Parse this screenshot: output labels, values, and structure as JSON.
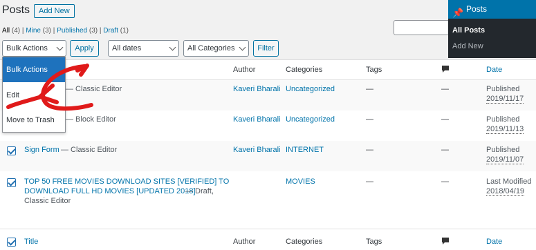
{
  "header": {
    "title": "Posts",
    "add_new": "Add New"
  },
  "filters": {
    "all": "All",
    "all_count": "(4)",
    "mine": "Mine",
    "mine_count": "(3)",
    "published": "Published",
    "published_count": "(3)",
    "draft": "Draft",
    "draft_count": "(1)",
    "sep": "|"
  },
  "toolbar": {
    "bulk_actions": "Bulk Actions",
    "apply": "Apply",
    "dates": "All dates",
    "categories": "All Categories",
    "filter": "Filter"
  },
  "bulk_menu": {
    "options": [
      "Bulk Actions",
      "Edit",
      "Move to Trash"
    ]
  },
  "table": {
    "columns": {
      "title": "Title",
      "author": "Author",
      "categories": "Categories",
      "tags": "Tags",
      "date": "Date"
    },
    "rows": [
      {
        "title": "",
        "suffix": "— Classic Editor",
        "author": "Kaveri Bharali",
        "category": "Uncategorized",
        "tags": "—",
        "comments": "—",
        "status": "Published",
        "date": "2019/11/17"
      },
      {
        "title": "",
        "suffix": "— Block Editor",
        "author": "Kaveri Bharali",
        "category": "Uncategorized",
        "tags": "—",
        "comments": "—",
        "status": "Published",
        "date": "2019/11/13"
      },
      {
        "title": "Sign Form",
        "suffix": "— Classic Editor",
        "author": "Kaveri Bharali",
        "category": "INTERNET",
        "tags": "—",
        "comments": "—",
        "status": "Published",
        "date": "2019/11/07"
      },
      {
        "title_line1": "TOP 50 FREE MOVIES DOWNLOAD SITES [VERIFIED] TO",
        "title_line2": "DOWNLOAD FULL HD MOVIES [UPDATED 2018]",
        "suffix_line2": " — Draft,",
        "suffix_line3": "Classic Editor",
        "category": "MOVIES",
        "tags": "—",
        "comments": "—",
        "status": "Last Modified",
        "date": "2018/04/19"
      }
    ]
  },
  "sidebar": {
    "title": "Posts",
    "all_posts": "All Posts",
    "add_new": "Add New"
  },
  "colors": {
    "accent": "#0073aa",
    "annotation_arrow": "#e01a1a",
    "sidebar_bg": "#23282d"
  }
}
